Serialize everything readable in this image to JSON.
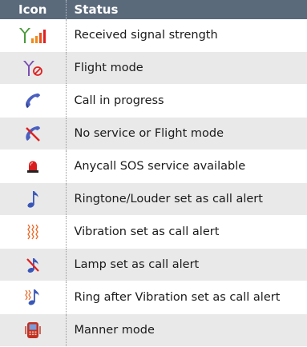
{
  "header": {
    "icon": "Icon",
    "status": "Status"
  },
  "rows": [
    {
      "icon": "signal-strength-icon",
      "label": "Received signal strength"
    },
    {
      "icon": "flight-mode-icon",
      "label": "Flight mode"
    },
    {
      "icon": "call-in-progress-icon",
      "label": "Call in progress"
    },
    {
      "icon": "no-service-icon",
      "label": "No service or Flight mode"
    },
    {
      "icon": "sos-alarm-icon",
      "label": "Anycall SOS service available"
    },
    {
      "icon": "ringtone-note-icon",
      "label": "Ringtone/Louder set as call alert"
    },
    {
      "icon": "vibration-icon",
      "label": "Vibration set as call alert"
    },
    {
      "icon": "lamp-alert-icon",
      "label": "Lamp set as call alert"
    },
    {
      "icon": "ring-after-vibration-icon",
      "label": "Ring after Vibration set as call alert"
    },
    {
      "icon": "manner-mode-icon",
      "label": "Manner mode"
    }
  ],
  "colors": {
    "header_bg": "#5b6a7b",
    "row_alt_bg": "#e9e9e9",
    "signal_green": "#4a9a3a",
    "signal_orange": "#f08a1a",
    "signal_red": "#e02020",
    "icon_purple": "#7a4fb0",
    "icon_blue": "#3a57b8"
  }
}
